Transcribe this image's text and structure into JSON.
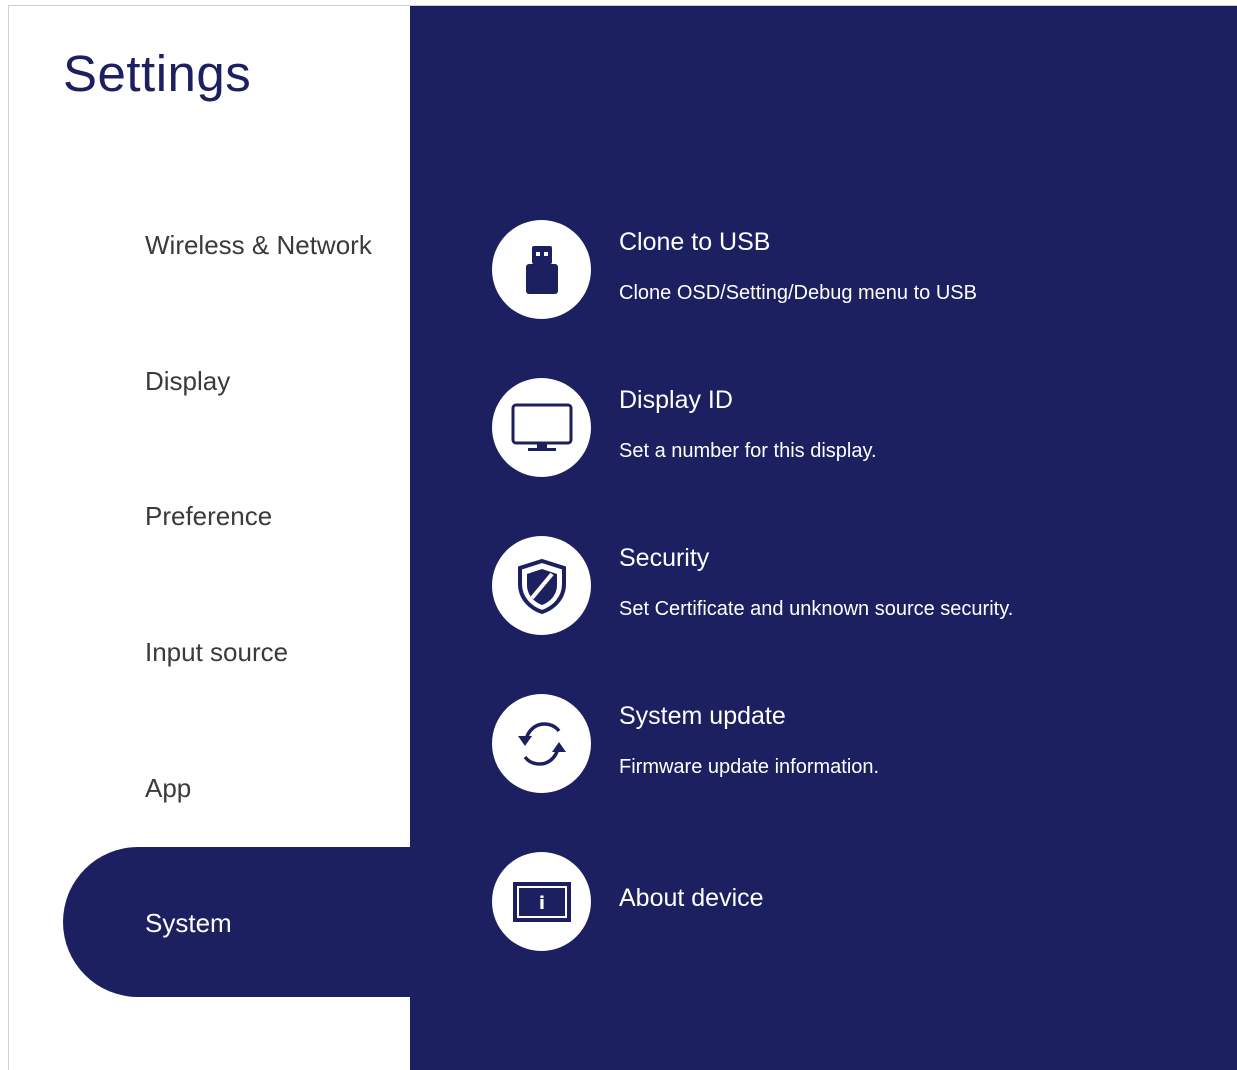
{
  "page": {
    "title": "Settings"
  },
  "sidebar": {
    "items": [
      {
        "label": "Wireless & Network",
        "active": false
      },
      {
        "label": "Display",
        "active": false
      },
      {
        "label": "Preference",
        "active": false
      },
      {
        "label": "Input source",
        "active": false
      },
      {
        "label": "App",
        "active": false
      },
      {
        "label": "System",
        "active": true
      }
    ]
  },
  "main": {
    "items": [
      {
        "title": "Clone to USB",
        "description": "Clone OSD/Setting/Debug menu to USB",
        "icon": "usb-drive-icon"
      },
      {
        "title": "Display ID",
        "description": "Set a number for this display.",
        "icon": "monitor-icon"
      },
      {
        "title": "Security",
        "description": "Set Certificate and unknown source security.",
        "icon": "shield-icon"
      },
      {
        "title": "System update",
        "description": "Firmware update information.",
        "icon": "sync-arrows-icon"
      },
      {
        "title": "About device",
        "description": "",
        "icon": "info-icon"
      }
    ]
  },
  "colors": {
    "primary": "#1d2060",
    "background": "#ffffff",
    "nav_text": "#3a3a3a"
  }
}
